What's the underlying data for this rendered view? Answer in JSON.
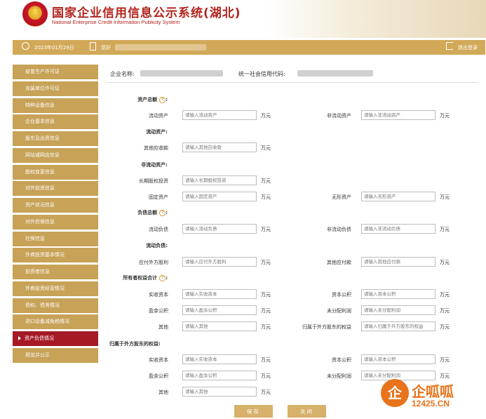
{
  "header": {
    "title": "国家企业信用信息公示系统(湖北)",
    "subtitle": "National Enterprise Credit Information Publicity System"
  },
  "topbar": {
    "date": "2023年01月29日",
    "greeting": "您好",
    "logout": "退出登录"
  },
  "sidebar": {
    "items": [
      {
        "label": "疫苗生产许可证",
        "active": false
      },
      {
        "label": "充装单位许可证",
        "active": false
      },
      {
        "label": "特种设备信息",
        "active": false
      },
      {
        "label": "企业基本信息",
        "active": false
      },
      {
        "label": "股东及出资信息",
        "active": false
      },
      {
        "label": "网站或网店信息",
        "active": false
      },
      {
        "label": "股权变更信息",
        "active": false
      },
      {
        "label": "对外投资信息",
        "active": false
      },
      {
        "label": "资产状况信息",
        "active": false
      },
      {
        "label": "对外担保信息",
        "active": false
      },
      {
        "label": "社保信息",
        "active": false
      },
      {
        "label": "外商投资基本情况",
        "active": false
      },
      {
        "label": "投资者信息",
        "active": false
      },
      {
        "label": "外商投资经营情况",
        "active": false
      },
      {
        "label": "债权、债务情况",
        "active": false
      },
      {
        "label": "进口设备减免税情况",
        "active": false
      },
      {
        "label": "资产负债情况",
        "active": true
      },
      {
        "label": "预览并公示",
        "active": false
      }
    ]
  },
  "enterprise": {
    "name_label": "企业名称:",
    "code_label": "统一社会信用代码:"
  },
  "form": {
    "unit": "万元",
    "sections": {
      "total_assets": "资产总额",
      "current_assets": "流动资产:",
      "noncurrent_assets": "非流动资产:",
      "total_liabilities": "负债总额",
      "current_liabilities": "流动负债:",
      "owners_equity": "所有者权益合计",
      "parent_equity": "归属于外方股东的权益:"
    },
    "fields": {
      "current_assets": {
        "label": "流动资产",
        "placeholder": "请输入流动资产"
      },
      "noncurrent_assets": {
        "label": "非流动资产",
        "placeholder": "请输入非流动资产"
      },
      "other_receivables": {
        "label": "其他应收款",
        "placeholder": "请输入其他应收款"
      },
      "lt_equity_invest": {
        "label": "长期股权投资",
        "placeholder": "请输入长期股权投资"
      },
      "fixed_assets": {
        "label": "固定资产",
        "placeholder": "请输入固定资产"
      },
      "intangible_assets": {
        "label": "无形资产",
        "placeholder": "请输入无形资产"
      },
      "current_liab": {
        "label": "流动负债",
        "placeholder": "请输入流动负债"
      },
      "noncurrent_liab": {
        "label": "非流动负债",
        "placeholder": "请输入非流动负债"
      },
      "dividends_payable": {
        "label": "应付外方股利",
        "placeholder": "请输入应付外方股利"
      },
      "other_payables": {
        "label": "其他应付款",
        "placeholder": "请输入其他应付款"
      },
      "paid_capital": {
        "label": "实收资本",
        "placeholder": "请输入实收资本"
      },
      "capital_reserve": {
        "label": "资本公积",
        "placeholder": "请输入资本公积"
      },
      "surplus_reserve": {
        "label": "盈余公积",
        "placeholder": "请输入盈余公积"
      },
      "undistributed_profit": {
        "label": "未分配利润",
        "placeholder": "请输入未分配利润"
      },
      "other": {
        "label": "其他",
        "placeholder": "请输入其他"
      },
      "foreign_equity": {
        "label": "归属于外方股东的权益",
        "placeholder": "请输入归属于外方股东的权益"
      },
      "f_paid_capital": {
        "label": "实收资本",
        "placeholder": "请输入实收资本"
      },
      "f_capital_reserve": {
        "label": "资本公积",
        "placeholder": "请输入资本公积"
      },
      "f_surplus_reserve": {
        "label": "盈余公积",
        "placeholder": "请输入盈余公积"
      },
      "f_undistributed_profit": {
        "label": "未分配利润",
        "placeholder": "请输入未分配利润"
      },
      "f_other": {
        "label": "其他",
        "placeholder": "请输入其他"
      }
    }
  },
  "buttons": {
    "save": "保存",
    "close": "关闭"
  },
  "watermark": {
    "brand": "企呱呱",
    "domain": "12425.CN"
  }
}
